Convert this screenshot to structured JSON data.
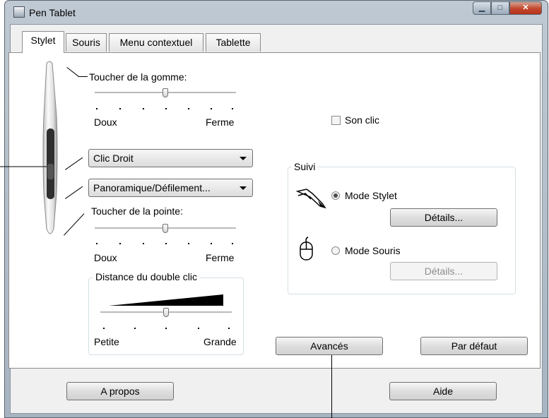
{
  "window": {
    "title": "Pen Tablet",
    "minimize_glyph": "▁",
    "maximize_glyph": "□",
    "close_glyph": "✕"
  },
  "tabs": [
    {
      "label": "Stylet",
      "active": true
    },
    {
      "label": "Souris",
      "active": false
    },
    {
      "label": "Menu contextuel",
      "active": false
    },
    {
      "label": "Tablette",
      "active": false
    }
  ],
  "stylet": {
    "eraser_feel": {
      "label": "Toucher de la gomme:",
      "min_label": "Doux",
      "max_label": "Ferme",
      "level": 0.5
    },
    "upper_button": {
      "selected": "Clic Droit"
    },
    "lower_button": {
      "selected": "Panoramique/Défilement..."
    },
    "tip_feel": {
      "label": "Toucher de la pointe:",
      "min_label": "Doux",
      "max_label": "Ferme",
      "level": 0.5
    },
    "double_click_distance": {
      "label": "Distance du double clic",
      "min_label": "Petite",
      "max_label": "Grande",
      "level": 0.5
    },
    "click_sound": {
      "label": "Son clic",
      "checked": false
    },
    "tracking": {
      "title": "Suivi",
      "pen_mode": {
        "label": "Mode Stylet",
        "selected": true,
        "details_label": "Détails..."
      },
      "mouse_mode": {
        "label": "Mode Souris",
        "selected": false,
        "details_label": "Détails..."
      }
    },
    "advanced_label": "Avancés",
    "default_label": "Par défaut"
  },
  "footer": {
    "about_label": "A propos",
    "help_label": "Aide"
  },
  "colors": {
    "accent_close": "#c2462c",
    "panel_bg": "#ffffff",
    "client_bg": "#f0f0f0"
  }
}
